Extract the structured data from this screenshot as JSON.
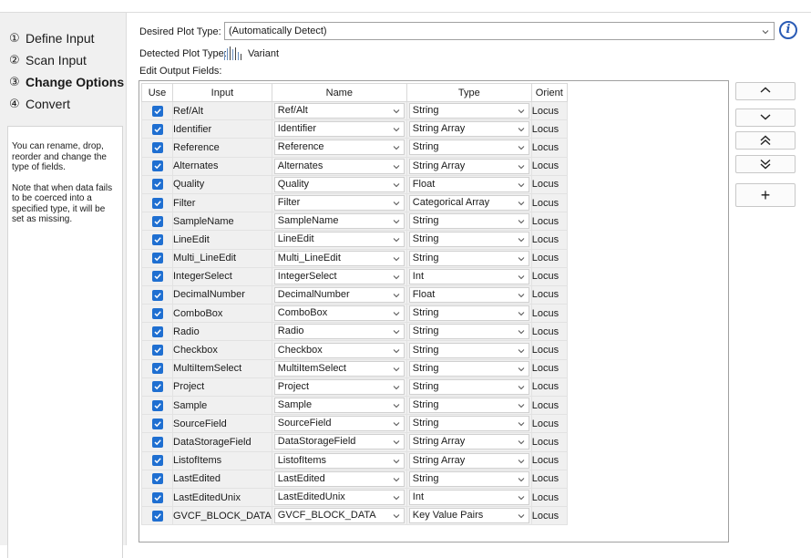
{
  "wizard": {
    "steps": [
      {
        "num": "①",
        "label": "Define Input"
      },
      {
        "num": "②",
        "label": "Scan Input"
      },
      {
        "num": "③",
        "label": "Change Options"
      },
      {
        "num": "④",
        "label": "Convert"
      }
    ],
    "active_step": 2,
    "help_text": [
      "You can rename, drop, reorder and change the type of fields.",
      "Note that when data fails to be coerced into a specified type, it will be set as missing."
    ]
  },
  "options": {
    "desired_plot_type_label": "Desired Plot Type:",
    "desired_plot_type_value": "(Automatically Detect)",
    "detected_plot_type_label": "Detected Plot Type:",
    "detected_plot_type_value": "Variant",
    "edit_output_fields_label": "Edit Output Fields:",
    "info_icon_glyph": "i"
  },
  "table": {
    "headers": {
      "use": "Use",
      "input": "Input",
      "name": "Name",
      "type": "Type",
      "orient": "Orient"
    },
    "rows": [
      {
        "use": true,
        "input": "Ref/Alt",
        "name": "Ref/Alt",
        "type": "String",
        "orient": "Locus"
      },
      {
        "use": true,
        "input": "Identifier",
        "name": "Identifier",
        "type": "String Array",
        "orient": "Locus"
      },
      {
        "use": true,
        "input": "Reference",
        "name": "Reference",
        "type": "String",
        "orient": "Locus"
      },
      {
        "use": true,
        "input": "Alternates",
        "name": "Alternates",
        "type": "String Array",
        "orient": "Locus"
      },
      {
        "use": true,
        "input": "Quality",
        "name": "Quality",
        "type": "Float",
        "orient": "Locus"
      },
      {
        "use": true,
        "input": "Filter",
        "name": "Filter",
        "type": "Categorical Array",
        "orient": "Locus"
      },
      {
        "use": true,
        "input": "SampleName",
        "name": "SampleName",
        "type": "String",
        "orient": "Locus"
      },
      {
        "use": true,
        "input": "LineEdit",
        "name": "LineEdit",
        "type": "String",
        "orient": "Locus"
      },
      {
        "use": true,
        "input": "Multi_LineEdit",
        "name": "Multi_LineEdit",
        "type": "String",
        "orient": "Locus"
      },
      {
        "use": true,
        "input": "IntegerSelect",
        "name": "IntegerSelect",
        "type": "Int",
        "orient": "Locus"
      },
      {
        "use": true,
        "input": "DecimalNumber",
        "name": "DecimalNumber",
        "type": "Float",
        "orient": "Locus"
      },
      {
        "use": true,
        "input": "ComboBox",
        "name": "ComboBox",
        "type": "String",
        "orient": "Locus"
      },
      {
        "use": true,
        "input": "Radio",
        "name": "Radio",
        "type": "String",
        "orient": "Locus"
      },
      {
        "use": true,
        "input": "Checkbox",
        "name": "Checkbox",
        "type": "String",
        "orient": "Locus"
      },
      {
        "use": true,
        "input": "MultiItemSelect",
        "name": "MultiItemSelect",
        "type": "String",
        "orient": "Locus"
      },
      {
        "use": true,
        "input": "Project",
        "name": "Project",
        "type": "String",
        "orient": "Locus"
      },
      {
        "use": true,
        "input": "Sample",
        "name": "Sample",
        "type": "String",
        "orient": "Locus"
      },
      {
        "use": true,
        "input": "SourceField",
        "name": "SourceField",
        "type": "String",
        "orient": "Locus"
      },
      {
        "use": true,
        "input": "DataStorageField",
        "name": "DataStorageField",
        "type": "String Array",
        "orient": "Locus"
      },
      {
        "use": true,
        "input": "ListofItems",
        "name": "ListofItems",
        "type": "String Array",
        "orient": "Locus"
      },
      {
        "use": true,
        "input": "LastEdited",
        "name": "LastEdited",
        "type": "String",
        "orient": "Locus"
      },
      {
        "use": true,
        "input": "LastEditedUnix",
        "name": "LastEditedUnix",
        "type": "Int",
        "orient": "Locus"
      },
      {
        "use": true,
        "input": "GVCF_BLOCK_DATA",
        "name": "GVCF_BLOCK_DATA",
        "type": "Key Value Pairs",
        "orient": "Locus"
      }
    ]
  },
  "side_buttons": [
    {
      "name": "move-up-button",
      "icon": "chevron-up-icon"
    },
    {
      "name": "move-down-button",
      "icon": "chevron-down-icon"
    },
    {
      "name": "move-to-top-button",
      "icon": "double-chevron-up-icon"
    },
    {
      "name": "move-to-bottom-button",
      "icon": "double-chevron-down-icon"
    },
    {
      "name": "add-field-button",
      "icon": "plus-icon",
      "glyph": "+"
    }
  ],
  "colors": {
    "accent": "#1f6fd1",
    "info": "#2a5bb5",
    "panel": "#f0f0f0"
  }
}
